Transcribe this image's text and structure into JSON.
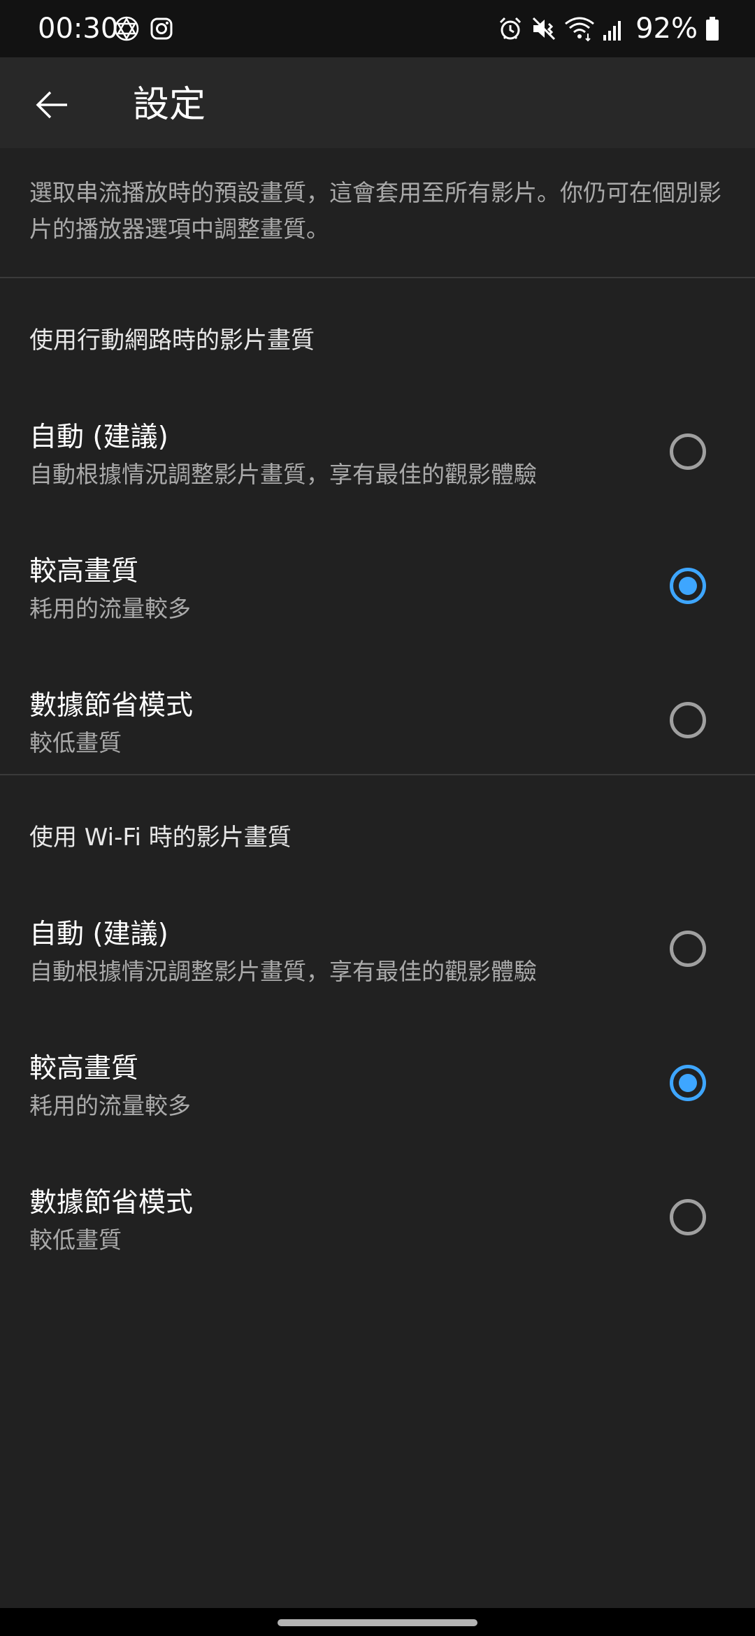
{
  "status_bar": {
    "time": "00:30",
    "left_icons": [
      "hexagram-icon",
      "instagram-icon"
    ],
    "right_icons": [
      "alarm-icon",
      "mute-vibrate-icon",
      "wifi-icon",
      "signal-icon"
    ],
    "battery_percent": "92%",
    "battery_icon": "battery-icon"
  },
  "app_bar": {
    "back_icon": "arrow-back-icon",
    "title": "設定"
  },
  "description": "選取串流播放時的預設畫質，這會套用至所有影片。你仍可在個別影片的播放器選項中調整畫質。",
  "sections": [
    {
      "header": "使用行動網路時的影片畫質",
      "options": [
        {
          "title": "自動 (建議)",
          "subtitle": "自動根據情況調整影片畫質，享有最佳的觀影體驗",
          "selected": false
        },
        {
          "title": "較高畫質",
          "subtitle": "耗用的流量較多",
          "selected": true
        },
        {
          "title": "數據節省模式",
          "subtitle": "較低畫質",
          "selected": false
        }
      ]
    },
    {
      "header": "使用 Wi-Fi 時的影片畫質",
      "options": [
        {
          "title": "自動 (建議)",
          "subtitle": "自動根據情況調整影片畫質，享有最佳的觀影體驗",
          "selected": false
        },
        {
          "title": "較高畫質",
          "subtitle": "耗用的流量較多",
          "selected": true
        },
        {
          "title": "數據節省模式",
          "subtitle": "較低畫質",
          "selected": false
        }
      ]
    }
  ],
  "colors": {
    "background": "#212121",
    "app_bar": "#282828",
    "status_bar": "#121212",
    "accent": "#3ea6ff",
    "secondary_text": "#aaaaaa"
  }
}
